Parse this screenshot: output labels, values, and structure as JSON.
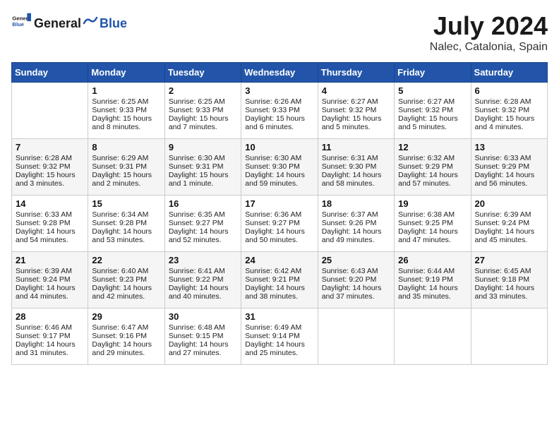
{
  "header": {
    "logo": {
      "general": "General",
      "blue": "Blue"
    },
    "title": "July 2024",
    "location": "Nalec, Catalonia, Spain"
  },
  "weekdays": [
    "Sunday",
    "Monday",
    "Tuesday",
    "Wednesday",
    "Thursday",
    "Friday",
    "Saturday"
  ],
  "weeks": [
    [
      {
        "day": "",
        "empty": true
      },
      {
        "day": "1",
        "sunrise": "Sunrise: 6:25 AM",
        "sunset": "Sunset: 9:33 PM",
        "daylight": "Daylight: 15 hours and 8 minutes."
      },
      {
        "day": "2",
        "sunrise": "Sunrise: 6:25 AM",
        "sunset": "Sunset: 9:33 PM",
        "daylight": "Daylight: 15 hours and 7 minutes."
      },
      {
        "day": "3",
        "sunrise": "Sunrise: 6:26 AM",
        "sunset": "Sunset: 9:33 PM",
        "daylight": "Daylight: 15 hours and 6 minutes."
      },
      {
        "day": "4",
        "sunrise": "Sunrise: 6:27 AM",
        "sunset": "Sunset: 9:32 PM",
        "daylight": "Daylight: 15 hours and 5 minutes."
      },
      {
        "day": "5",
        "sunrise": "Sunrise: 6:27 AM",
        "sunset": "Sunset: 9:32 PM",
        "daylight": "Daylight: 15 hours and 5 minutes."
      },
      {
        "day": "6",
        "sunrise": "Sunrise: 6:28 AM",
        "sunset": "Sunset: 9:32 PM",
        "daylight": "Daylight: 15 hours and 4 minutes."
      }
    ],
    [
      {
        "day": "7",
        "sunrise": "Sunrise: 6:28 AM",
        "sunset": "Sunset: 9:32 PM",
        "daylight": "Daylight: 15 hours and 3 minutes."
      },
      {
        "day": "8",
        "sunrise": "Sunrise: 6:29 AM",
        "sunset": "Sunset: 9:31 PM",
        "daylight": "Daylight: 15 hours and 2 minutes."
      },
      {
        "day": "9",
        "sunrise": "Sunrise: 6:30 AM",
        "sunset": "Sunset: 9:31 PM",
        "daylight": "Daylight: 15 hours and 1 minute."
      },
      {
        "day": "10",
        "sunrise": "Sunrise: 6:30 AM",
        "sunset": "Sunset: 9:30 PM",
        "daylight": "Daylight: 14 hours and 59 minutes."
      },
      {
        "day": "11",
        "sunrise": "Sunrise: 6:31 AM",
        "sunset": "Sunset: 9:30 PM",
        "daylight": "Daylight: 14 hours and 58 minutes."
      },
      {
        "day": "12",
        "sunrise": "Sunrise: 6:32 AM",
        "sunset": "Sunset: 9:29 PM",
        "daylight": "Daylight: 14 hours and 57 minutes."
      },
      {
        "day": "13",
        "sunrise": "Sunrise: 6:33 AM",
        "sunset": "Sunset: 9:29 PM",
        "daylight": "Daylight: 14 hours and 56 minutes."
      }
    ],
    [
      {
        "day": "14",
        "sunrise": "Sunrise: 6:33 AM",
        "sunset": "Sunset: 9:28 PM",
        "daylight": "Daylight: 14 hours and 54 minutes."
      },
      {
        "day": "15",
        "sunrise": "Sunrise: 6:34 AM",
        "sunset": "Sunset: 9:28 PM",
        "daylight": "Daylight: 14 hours and 53 minutes."
      },
      {
        "day": "16",
        "sunrise": "Sunrise: 6:35 AM",
        "sunset": "Sunset: 9:27 PM",
        "daylight": "Daylight: 14 hours and 52 minutes."
      },
      {
        "day": "17",
        "sunrise": "Sunrise: 6:36 AM",
        "sunset": "Sunset: 9:27 PM",
        "daylight": "Daylight: 14 hours and 50 minutes."
      },
      {
        "day": "18",
        "sunrise": "Sunrise: 6:37 AM",
        "sunset": "Sunset: 9:26 PM",
        "daylight": "Daylight: 14 hours and 49 minutes."
      },
      {
        "day": "19",
        "sunrise": "Sunrise: 6:38 AM",
        "sunset": "Sunset: 9:25 PM",
        "daylight": "Daylight: 14 hours and 47 minutes."
      },
      {
        "day": "20",
        "sunrise": "Sunrise: 6:39 AM",
        "sunset": "Sunset: 9:24 PM",
        "daylight": "Daylight: 14 hours and 45 minutes."
      }
    ],
    [
      {
        "day": "21",
        "sunrise": "Sunrise: 6:39 AM",
        "sunset": "Sunset: 9:24 PM",
        "daylight": "Daylight: 14 hours and 44 minutes."
      },
      {
        "day": "22",
        "sunrise": "Sunrise: 6:40 AM",
        "sunset": "Sunset: 9:23 PM",
        "daylight": "Daylight: 14 hours and 42 minutes."
      },
      {
        "day": "23",
        "sunrise": "Sunrise: 6:41 AM",
        "sunset": "Sunset: 9:22 PM",
        "daylight": "Daylight: 14 hours and 40 minutes."
      },
      {
        "day": "24",
        "sunrise": "Sunrise: 6:42 AM",
        "sunset": "Sunset: 9:21 PM",
        "daylight": "Daylight: 14 hours and 38 minutes."
      },
      {
        "day": "25",
        "sunrise": "Sunrise: 6:43 AM",
        "sunset": "Sunset: 9:20 PM",
        "daylight": "Daylight: 14 hours and 37 minutes."
      },
      {
        "day": "26",
        "sunrise": "Sunrise: 6:44 AM",
        "sunset": "Sunset: 9:19 PM",
        "daylight": "Daylight: 14 hours and 35 minutes."
      },
      {
        "day": "27",
        "sunrise": "Sunrise: 6:45 AM",
        "sunset": "Sunset: 9:18 PM",
        "daylight": "Daylight: 14 hours and 33 minutes."
      }
    ],
    [
      {
        "day": "28",
        "sunrise": "Sunrise: 6:46 AM",
        "sunset": "Sunset: 9:17 PM",
        "daylight": "Daylight: 14 hours and 31 minutes."
      },
      {
        "day": "29",
        "sunrise": "Sunrise: 6:47 AM",
        "sunset": "Sunset: 9:16 PM",
        "daylight": "Daylight: 14 hours and 29 minutes."
      },
      {
        "day": "30",
        "sunrise": "Sunrise: 6:48 AM",
        "sunset": "Sunset: 9:15 PM",
        "daylight": "Daylight: 14 hours and 27 minutes."
      },
      {
        "day": "31",
        "sunrise": "Sunrise: 6:49 AM",
        "sunset": "Sunset: 9:14 PM",
        "daylight": "Daylight: 14 hours and 25 minutes."
      },
      {
        "day": "",
        "empty": true
      },
      {
        "day": "",
        "empty": true
      },
      {
        "day": "",
        "empty": true
      }
    ]
  ]
}
